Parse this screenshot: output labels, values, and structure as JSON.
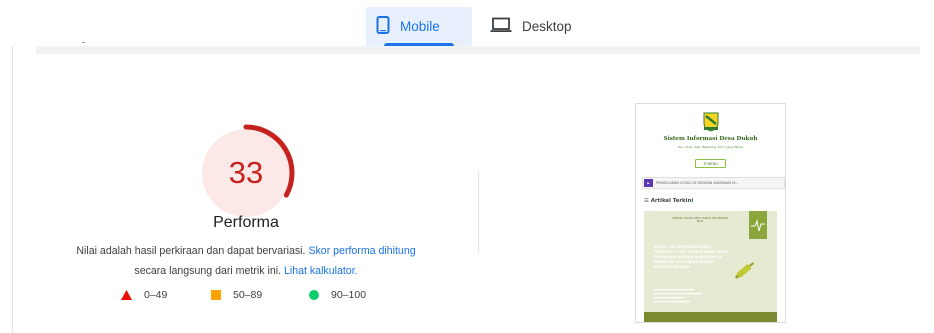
{
  "tabs": [
    {
      "label": "Mobile",
      "icon": "smartphone-icon",
      "selected": true
    },
    {
      "label": "Desktop",
      "icon": "laptop-icon",
      "selected": false
    }
  ],
  "score": {
    "value": "33",
    "fraction": 0.33,
    "label": "Performa",
    "color": "#c5221f",
    "fill": "#fce8e6",
    "description_text": "Nilai adalah hasil perkiraan dan dapat bervariasi.",
    "link_score": "Skor performa dihitung",
    "description_text_2": "secara langsung dari metrik ini.",
    "link_calc": "Lihat kalkulator."
  },
  "legend": [
    {
      "range": "0–49",
      "shape": "triangle-icon",
      "color": "#eb0f00"
    },
    {
      "range": "50–89",
      "shape": "square-icon",
      "color": "#ffa400"
    },
    {
      "range": "90–100",
      "shape": "circle-icon",
      "color": "#0cce6b"
    }
  ],
  "screenshot": {
    "site_title": "Sistem Informasi Desa Dukuh",
    "site_subtitle": "Kec. Ibun, Kab. Bandung, Prov. Jawa Barat",
    "menu_label": "☰ MENU",
    "ticker": "PENGELAKAN COVID-19 DENGAN VAKSINASI M...",
    "section_title": "☰ Artikel Terkini",
    "poster_head": "ARTIKEL VAKSIN DESA DUKUH KECAMATAN IBUN",
    "poster_main": "KAMIS, 16 SEPTEMBER 2021 TERSEDIA 1.107 VAKSIN YANG AKAN DIBERIKAN KEPADA WARGA DESA DUKUH DI AULA DESA DUKUH KECAMATAN IBUN"
  }
}
